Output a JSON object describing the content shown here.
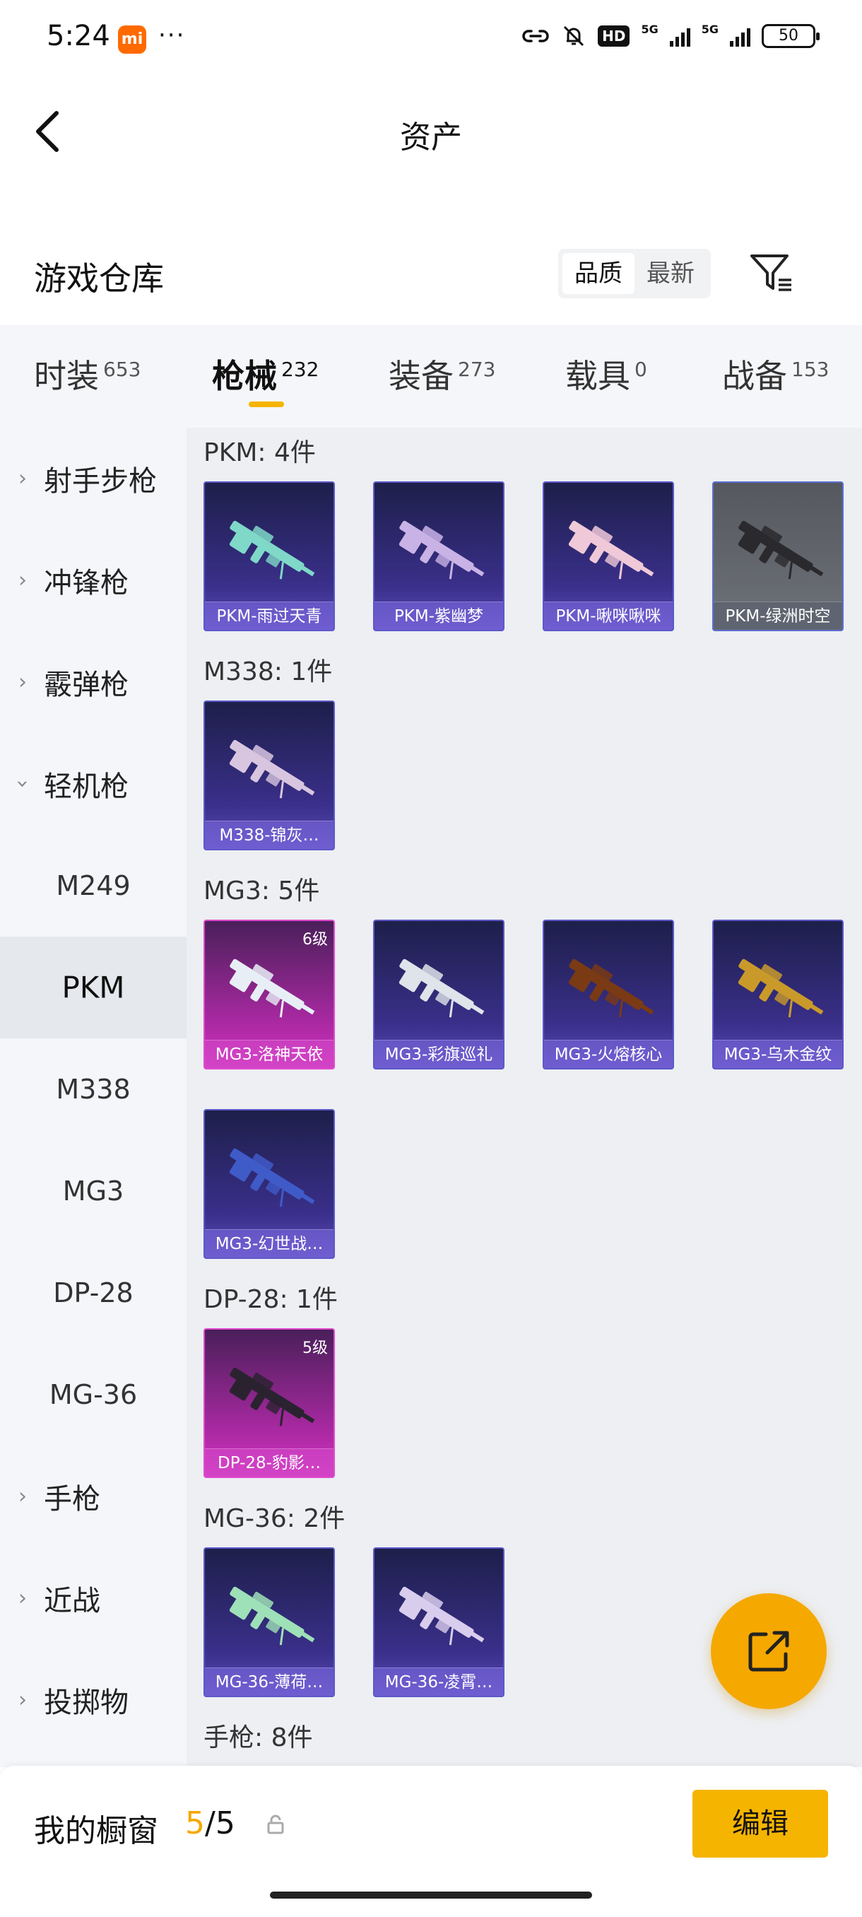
{
  "status_bar": {
    "time": "5:24",
    "mi_badge": "mi",
    "more": "···",
    "hd": "HD",
    "net1": "5G",
    "net2": "5G",
    "battery": "50"
  },
  "header": {
    "title": "资产"
  },
  "warehouse": {
    "title": "游戏仓库",
    "sort_options": [
      "品质",
      "最新"
    ],
    "active_sort": "品质"
  },
  "tabs": [
    {
      "label": "时装",
      "count": "653"
    },
    {
      "label": "枪械",
      "count": "232",
      "active": true
    },
    {
      "label": "装备",
      "count": "273"
    },
    {
      "label": "载具",
      "count": "0"
    },
    {
      "label": "战备",
      "count": "153"
    }
  ],
  "sidebar": {
    "items": [
      {
        "label": "射手步枪",
        "type": "category"
      },
      {
        "label": "冲锋枪",
        "type": "category"
      },
      {
        "label": "霰弹枪",
        "type": "category"
      },
      {
        "label": "轻机枪",
        "type": "category",
        "expanded": true
      },
      {
        "label": "M249",
        "type": "sub"
      },
      {
        "label": "PKM",
        "type": "sub",
        "selected": true
      },
      {
        "label": "M338",
        "type": "sub"
      },
      {
        "label": "MG3",
        "type": "sub"
      },
      {
        "label": "DP-28",
        "type": "sub"
      },
      {
        "label": "MG-36",
        "type": "sub"
      },
      {
        "label": "手枪",
        "type": "category"
      },
      {
        "label": "近战",
        "type": "category"
      },
      {
        "label": "投掷物",
        "type": "category"
      }
    ]
  },
  "groups": [
    {
      "title": "PKM: 4件",
      "items": [
        {
          "name": "PKM-雨过天青",
          "style": "purple",
          "gun_color": "#7fd8c8"
        },
        {
          "name": "PKM-紫幽梦",
          "style": "purple",
          "gun_color": "#c9b3e6"
        },
        {
          "name": "PKM-啾咪啾咪",
          "style": "purple",
          "gun_color": "#f0c9d8"
        },
        {
          "name": "PKM-绿洲时空",
          "style": "grey",
          "gun_color": "#2a2a2e"
        }
      ]
    },
    {
      "title": "M338: 1件",
      "items": [
        {
          "name": "M338-锦灰…",
          "style": "purple",
          "gun_color": "#d8c6e0"
        }
      ]
    },
    {
      "title": "MG3: 5件",
      "items": [
        {
          "name": "MG3-洛神天依",
          "style": "pink",
          "gun_color": "#e8eef6",
          "level": "6级"
        },
        {
          "name": "MG3-彩旗巡礼",
          "style": "purple",
          "gun_color": "#dfe3ea"
        },
        {
          "name": "MG3-火熔核心",
          "style": "purple",
          "gun_color": "#7a3a14"
        },
        {
          "name": "MG3-乌木金纹",
          "style": "purple",
          "gun_color": "#c99a2a"
        },
        {
          "name": "MG3-幻世战…",
          "style": "purple",
          "gun_color": "#3f5bc8"
        }
      ]
    },
    {
      "title": "DP-28: 1件",
      "items": [
        {
          "name": "DP-28-豹影…",
          "style": "pink",
          "gun_color": "#2b2230",
          "level": "5级"
        }
      ]
    },
    {
      "title": "MG-36: 2件",
      "items": [
        {
          "name": "MG-36-薄荷…",
          "style": "purple",
          "gun_color": "#9ee0b8"
        },
        {
          "name": "MG-36-凌霄…",
          "style": "purple",
          "gun_color": "#d9cdee"
        }
      ]
    },
    {
      "title": "手枪: 8件",
      "items": []
    }
  ],
  "bottom": {
    "label": "我的橱窗",
    "used": "5",
    "sep": "/",
    "total": "5",
    "edit": "编辑"
  },
  "colors": {
    "accent": "#f5b400",
    "fab": "#f5a800"
  }
}
